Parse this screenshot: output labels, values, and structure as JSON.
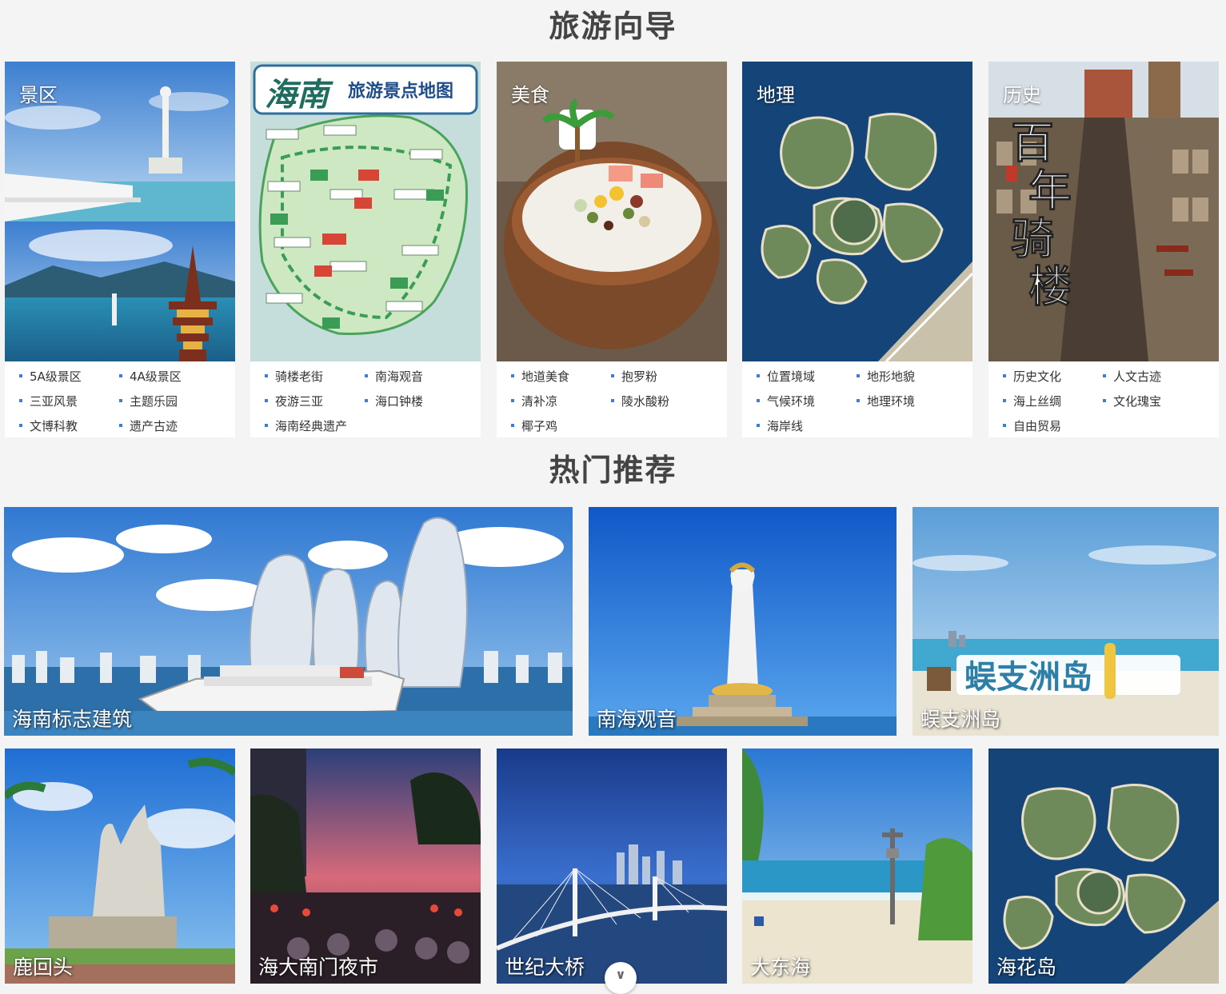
{
  "guide": {
    "title": "旅游向导",
    "cards": [
      {
        "label": "景区",
        "links": [
          "5A级景区",
          "4A级景区",
          "三亚风景",
          "主题乐园",
          "文博科教",
          "遗产古迹"
        ]
      },
      {
        "label": "",
        "map_title_big": "海南",
        "map_title_small": "旅游景点地图",
        "links": [
          "骑楼老街",
          "南海观音",
          "夜游三亚",
          "海口钟楼",
          "海南经典遗产"
        ]
      },
      {
        "label": "美食",
        "links": [
          "地道美食",
          "抱罗粉",
          "清补凉",
          "陵水酸粉",
          "椰子鸡"
        ]
      },
      {
        "label": "地理",
        "links": [
          "位置境域",
          "地形地貌",
          "气候环境",
          "地理环境",
          "海岸线"
        ]
      },
      {
        "label": "历史",
        "poster_text": [
          "百",
          "年",
          "骑",
          "楼"
        ],
        "links": [
          "历史文化",
          "人文古迹",
          "海上丝绸",
          "文化瑰宝",
          "自由贸易"
        ]
      }
    ]
  },
  "hot": {
    "title": "热门推荐",
    "tiles": [
      {
        "caption": "海南标志建筑"
      },
      {
        "caption": "南海观音"
      },
      {
        "caption": "蜈支洲岛",
        "sign_text": "蜈支洲岛"
      },
      {
        "caption": "鹿回头"
      },
      {
        "caption": "海大南门夜市"
      },
      {
        "caption": "世纪大桥"
      },
      {
        "caption": "大东海"
      },
      {
        "caption": "海花岛"
      }
    ]
  },
  "scroll_icon": "chevron-down-icon",
  "scroll_glyph": "∨"
}
